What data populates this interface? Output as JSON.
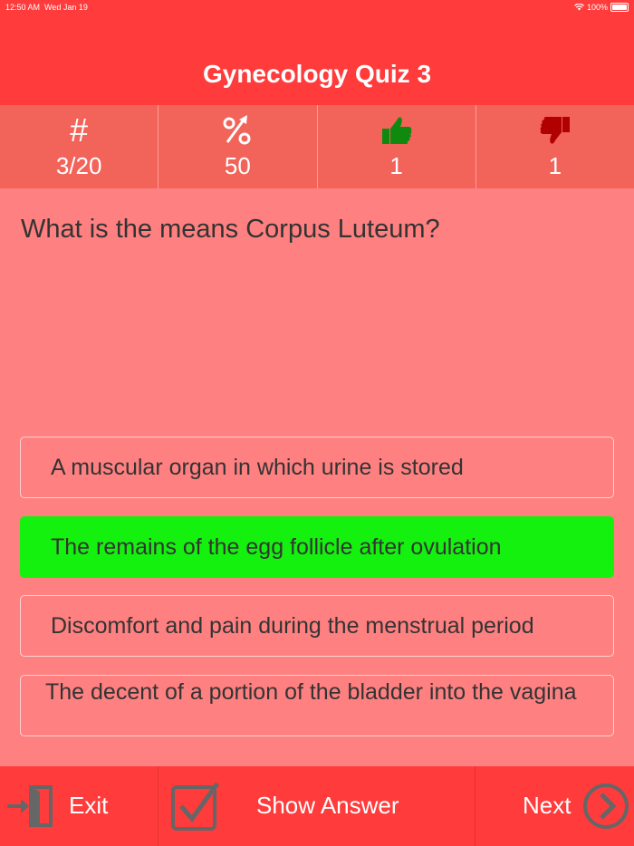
{
  "status_bar": {
    "time": "12:50 AM",
    "date": "Wed Jan 19",
    "battery": "100%"
  },
  "header": {
    "title": "Gynecology Quiz 3"
  },
  "stats": [
    {
      "icon": "hash-icon",
      "symbol": "#",
      "value": "3/20"
    },
    {
      "icon": "percent-arrow-icon",
      "value": "50"
    },
    {
      "icon": "thumbs-up-icon",
      "value": "1"
    },
    {
      "icon": "thumbs-down-icon",
      "value": "1"
    }
  ],
  "question": {
    "text": "What is the means Corpus Luteum?"
  },
  "answers": [
    {
      "text": "A muscular organ in which urine is stored",
      "selected": false
    },
    {
      "text": "The remains of the egg follicle after ovulation",
      "selected": true
    },
    {
      "text": "Discomfort and pain during the menstrual period",
      "selected": false
    },
    {
      "text": "The decent of a portion of the bladder into the vagina",
      "selected": false
    }
  ],
  "footer": {
    "exit_label": "Exit",
    "show_answer_label": "Show Answer",
    "next_label": "Next"
  },
  "colors": {
    "header": "#ff3b3b",
    "stats_bar": "#f2635a",
    "background": "#ff8080",
    "selected_answer": "#15f10f",
    "thumbs_up": "#0f8a0f",
    "thumbs_down": "#b00000"
  }
}
